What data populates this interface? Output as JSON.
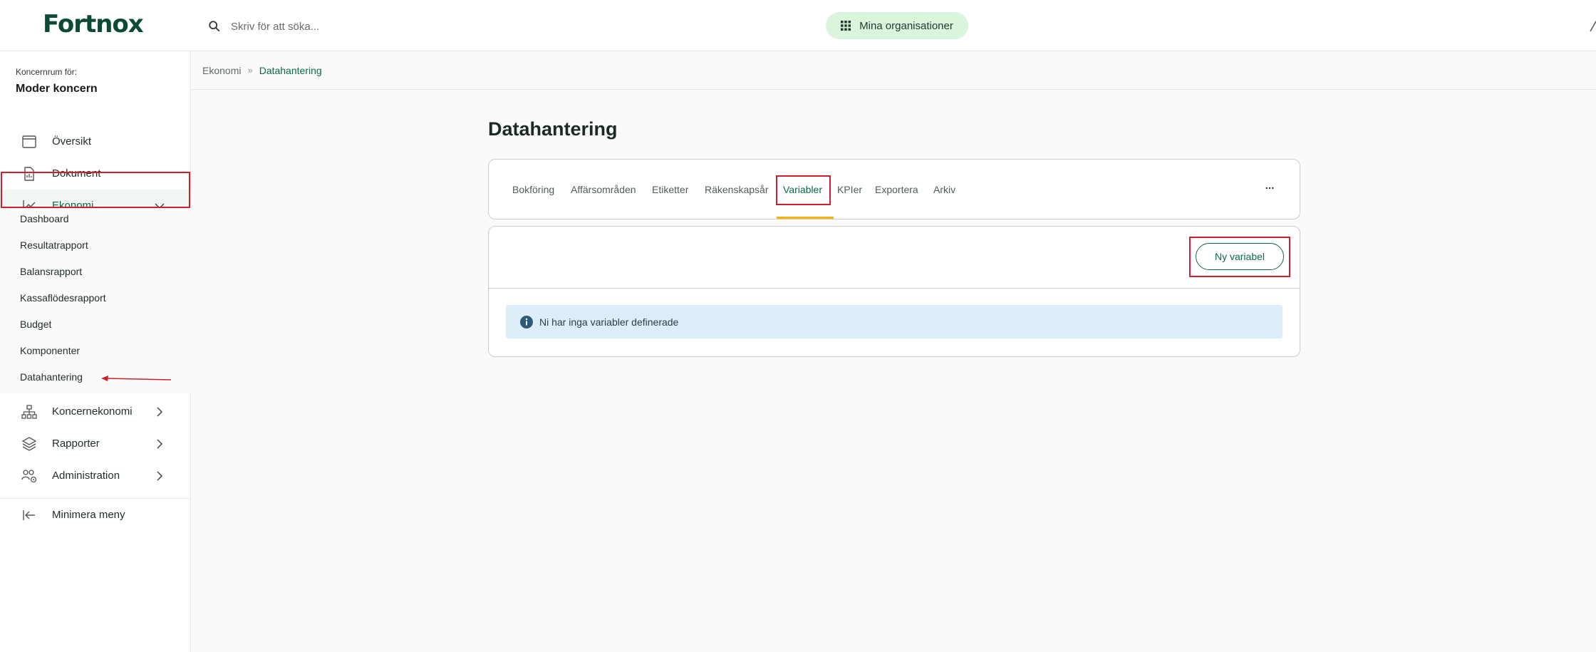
{
  "brand": {
    "logo_text": "Fortnox",
    "primary_color": "#0b6a4a",
    "highlight_color": "#d0202c",
    "tab_indicator_color": "#f4b400"
  },
  "header": {
    "search": {
      "placeholder": "Skriv för att söka...",
      "icon": "search-icon"
    },
    "org_button": {
      "label": "Mina organisationer",
      "icon": "grid-icon"
    }
  },
  "sidebar": {
    "context_label": "Koncernrum för:",
    "context_title": "Moder koncern",
    "items": [
      {
        "label": "Översikt",
        "icon": "browser-window-icon"
      },
      {
        "label": "Dokument",
        "icon": "document-icon"
      },
      {
        "label": "Ekonomi",
        "icon": "line-chart-icon",
        "expanded": true
      },
      {
        "label": "Koncernekonomi",
        "icon": "hierarchy-icon"
      },
      {
        "label": "Rapporter",
        "icon": "layers-icon"
      },
      {
        "label": "Administration",
        "icon": "users-gear-icon"
      }
    ],
    "ekonomi_subitems": [
      "Dashboard",
      "Resultatrapport",
      "Balansrapport",
      "Kassaflödesrapport",
      "Budget",
      "Komponenter",
      "Datahantering"
    ],
    "minimize": {
      "label": "Minimera meny",
      "icon": "collapse-left-icon"
    }
  },
  "breadcrumb": {
    "parent": "Ekonomi",
    "current": "Datahantering"
  },
  "main": {
    "title": "Datahantering",
    "tabs": [
      "Bokföring",
      "Affärsområden",
      "Etiketter",
      "Räkenskapsår",
      "Variabler",
      "KPIer",
      "Exportera",
      "Arkiv"
    ],
    "active_tab": "Variabler",
    "more_icon": "more-horizontal-icon",
    "new_button_label": "Ny variabel",
    "info_message": "Ni har inga variabler definerade"
  }
}
